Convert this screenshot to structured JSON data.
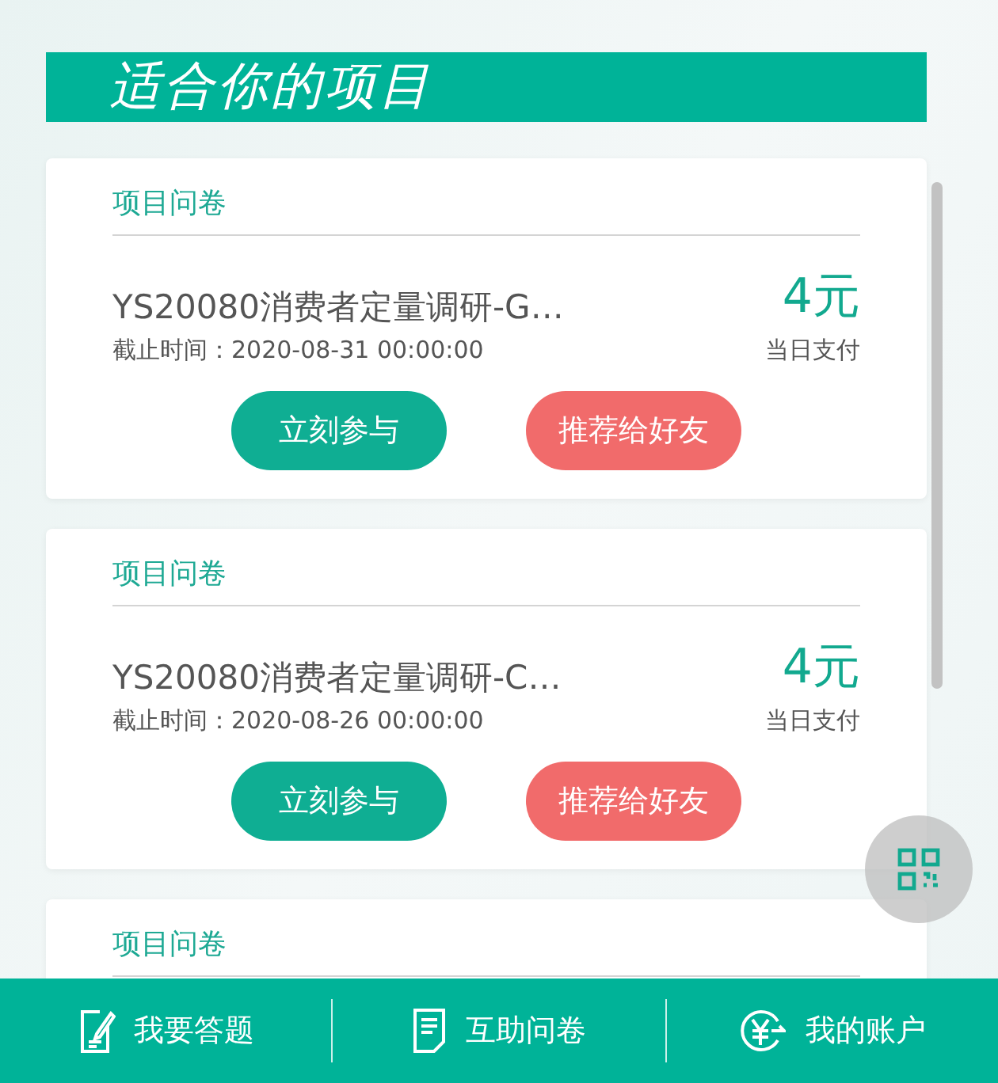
{
  "header": {
    "title": "适合你的项目"
  },
  "projects": [
    {
      "category": "项目问卷",
      "title": "YS20080消费者定量调研-G…",
      "deadline": "截止时间：2020-08-31 00:00:00",
      "price": "4元",
      "payment": "当日支付",
      "buttons": [
        {
          "kind": "primary",
          "label": "立刻参与"
        },
        {
          "kind": "share",
          "label": "推荐给好友"
        }
      ]
    },
    {
      "category": "项目问卷",
      "title": "YS20080消费者定量调研-C…",
      "deadline": "截止时间：2020-08-26 00:00:00",
      "price": "4元",
      "payment": "当日支付",
      "buttons": [
        {
          "kind": "primary",
          "label": "立刻参与"
        },
        {
          "kind": "share",
          "label": "推荐给好友"
        }
      ]
    },
    {
      "category": "项目问卷"
    }
  ],
  "nav": [
    {
      "kind": "answer",
      "label": "我要答题"
    },
    {
      "kind": "survey",
      "label": "互助问卷"
    },
    {
      "kind": "account",
      "label": "我的账户"
    }
  ]
}
